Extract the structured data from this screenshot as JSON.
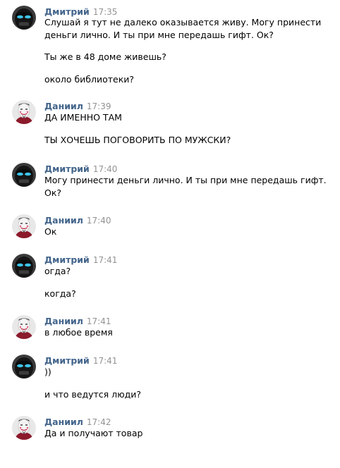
{
  "messages": [
    {
      "author": "Дмитрий",
      "time": "17:35",
      "avatar": "black-mask-avatar",
      "lines": [
        "Слушай я тут не далеко оказывается живу. Могу принести",
        "деньги лично. И ты при мне передашь гифт. Ок?",
        "Ты же в 48 доме живешь?",
        "около библиотеки?"
      ]
    },
    {
      "author": "Даниил",
      "time": "17:39",
      "avatar": "guy-fawkes-mask-avatar",
      "lines": [
        "ДА ИМЕННО ТАМ",
        "ТЫ ХОЧЕШЬ ПОГОВОРИТЬ ПО МУЖСКИ?"
      ]
    },
    {
      "author": "Дмитрий",
      "time": "17:40",
      "avatar": "black-mask-avatar",
      "lines": [
        "Могу принести деньги лично. И ты при мне передашь гифт.",
        "Ок?"
      ]
    },
    {
      "author": "Даниил",
      "time": "17:40",
      "avatar": "guy-fawkes-mask-avatar",
      "lines": [
        "Ок"
      ]
    },
    {
      "author": "Дмитрий",
      "time": "17:41",
      "avatar": "black-mask-avatar",
      "lines": [
        "огда?",
        "когда?"
      ]
    },
    {
      "author": "Даниил",
      "time": "17:41",
      "avatar": "guy-fawkes-mask-avatar",
      "lines": [
        "в любое время"
      ]
    },
    {
      "author": "Дмитрий",
      "time": "17:41",
      "avatar": "black-mask-avatar",
      "lines": [
        "))",
        "и что ведутся люди?"
      ]
    },
    {
      "author": "Даниил",
      "time": "17:42",
      "avatar": "guy-fawkes-mask-avatar",
      "lines": [
        "Да и получают товар"
      ]
    }
  ]
}
